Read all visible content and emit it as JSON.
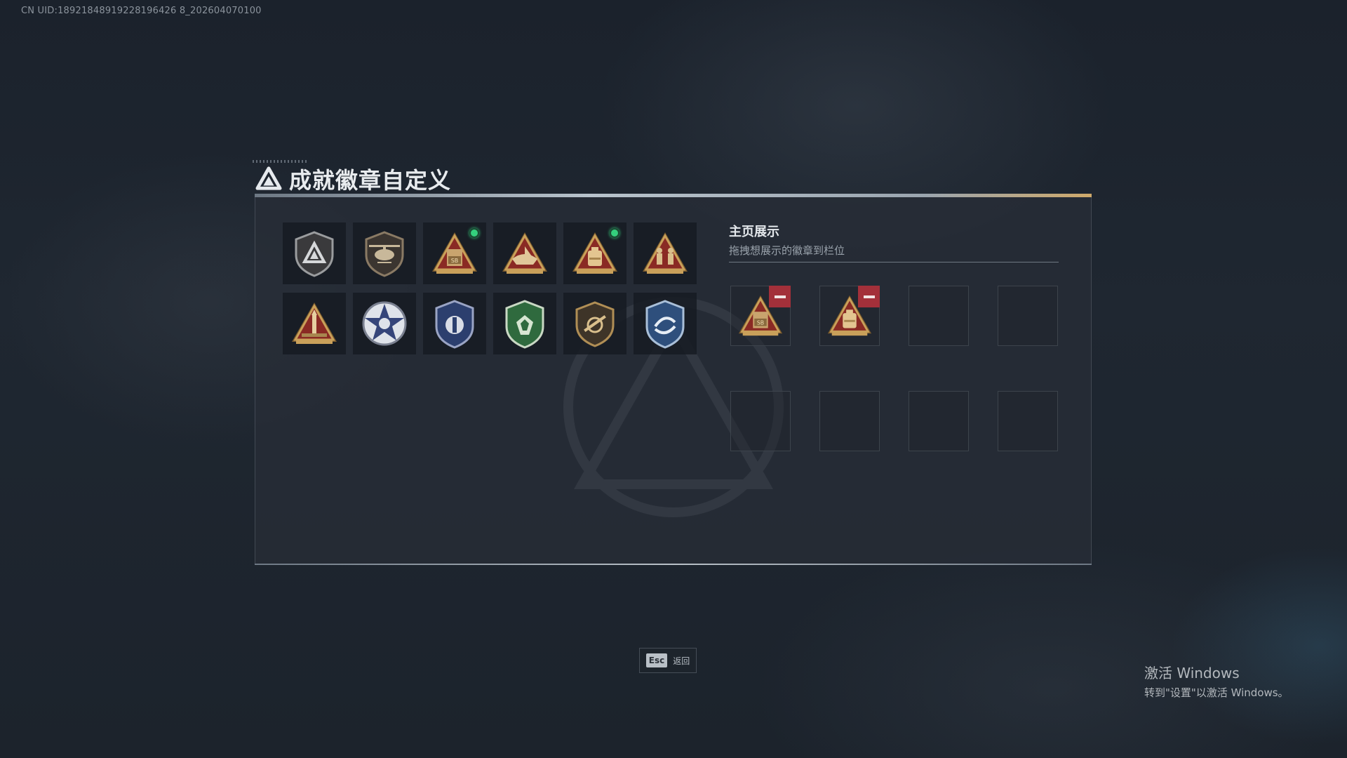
{
  "uid_text": "CN UID:18921848919228196426 8_202604070100",
  "header": {
    "title": "成就徽章自定义",
    "logo_icon": "delta-triangle-logo-icon"
  },
  "badges": [
    {
      "icon": "shield-delta-badge-icon",
      "new": false
    },
    {
      "icon": "helicopter-badge-icon",
      "new": false
    },
    {
      "icon": "triangle-sb-crate-badge-icon",
      "new": true
    },
    {
      "icon": "triangle-boat-badge-icon",
      "new": false
    },
    {
      "icon": "triangle-bag-badge-icon",
      "new": true
    },
    {
      "icon": "triangle-soldiers-badge-icon",
      "new": false
    },
    {
      "icon": "triangle-rocket-badge-icon",
      "new": false
    },
    {
      "icon": "star-wreath-badge-icon",
      "new": false
    },
    {
      "icon": "blue-shield-emblem-badge-icon",
      "new": false
    },
    {
      "icon": "green-shield-gem-badge-icon",
      "new": false
    },
    {
      "icon": "shield-rifle-badge-icon",
      "new": false
    },
    {
      "icon": "blue-shield-arrows-badge-icon",
      "new": false
    }
  ],
  "display": {
    "title": "主页展示",
    "subtitle": "拖拽想展示的徽章到栏位",
    "slots": [
      {
        "badge": "triangle-sb-crate-badge-icon"
      },
      {
        "badge": "triangle-bag-badge-icon"
      },
      {
        "badge": null
      },
      {
        "badge": null
      },
      {
        "badge": null
      },
      {
        "badge": null
      },
      {
        "badge": null
      },
      {
        "badge": null
      }
    ]
  },
  "footer": {
    "esc_key": "Esc",
    "esc_label": "返回"
  },
  "windows_activation": {
    "line1": "激活 Windows",
    "line2": "转到\"设置\"以激活 Windows。"
  },
  "colors": {
    "new_dot": "#34d07d",
    "remove_button": "#a3303a",
    "gold": "#c9a05a"
  }
}
